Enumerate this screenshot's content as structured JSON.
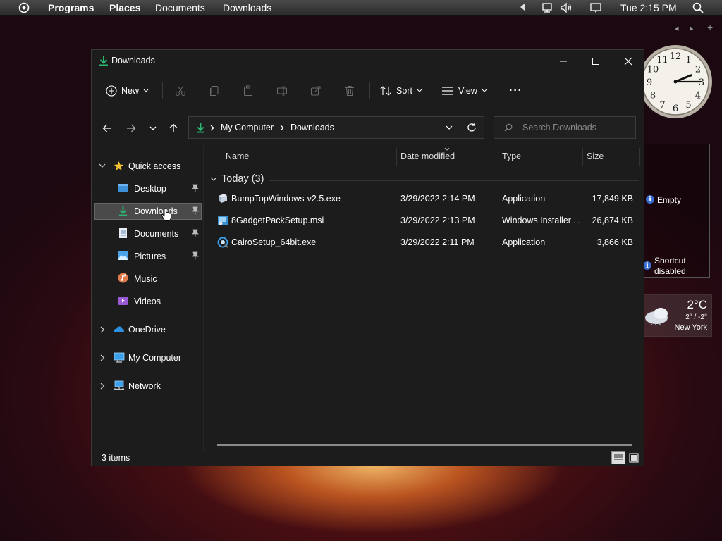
{
  "topbar": {
    "menus": [
      "Programs",
      "Places",
      "Documents",
      "Downloads"
    ],
    "clock": "Tue 2:15 PM"
  },
  "gadgets": {
    "nav_prev": "◂",
    "nav_next": "▸",
    "nav_add": "+",
    "recycle_empty": "Empty",
    "shortcut_line1": "Shortcut",
    "shortcut_line2": "disabled",
    "weather": {
      "temp": "2°C",
      "range": "2° / -2°",
      "city": "New York"
    },
    "clock_numbers": [
      "12",
      "1",
      "2",
      "3",
      "4",
      "5",
      "6",
      "7",
      "8",
      "9",
      "10",
      "11"
    ]
  },
  "window": {
    "title": "Downloads",
    "accent": "#2bb673",
    "toolbar": {
      "new_label": "New",
      "sort_label": "Sort",
      "view_label": "View",
      "more_label": "···"
    },
    "address": {
      "root": "My Computer",
      "current": "Downloads"
    },
    "search_placeholder": "Search Downloads",
    "sidebar": {
      "quick_access": "Quick access",
      "items": [
        {
          "label": "Desktop",
          "icon": "desktop-icon",
          "pinned": true
        },
        {
          "label": "Downloads",
          "icon": "download-icon",
          "pinned": true,
          "selected": true
        },
        {
          "label": "Documents",
          "icon": "document-icon",
          "pinned": true
        },
        {
          "label": "Pictures",
          "icon": "picture-icon",
          "pinned": true
        },
        {
          "label": "Music",
          "icon": "music-icon",
          "pinned": false
        },
        {
          "label": "Videos",
          "icon": "video-icon",
          "pinned": false
        }
      ],
      "onedrive": "OneDrive",
      "computer": "My Computer",
      "network": "Network"
    },
    "columns": {
      "name": "Name",
      "date": "Date modified",
      "type": "Type",
      "size": "Size"
    },
    "group": "Today (3)",
    "files": [
      {
        "name": "BumpTopWindows-v2.5.exe",
        "date": "3/29/2022 2:14 PM",
        "type": "Application",
        "size": "17,849 KB"
      },
      {
        "name": "8GadgetPackSetup.msi",
        "date": "3/29/2022 2:13 PM",
        "type": "Windows Installer ...",
        "size": "26,874 KB"
      },
      {
        "name": "CairoSetup_64bit.exe",
        "date": "3/29/2022 2:11 PM",
        "type": "Application",
        "size": "3,866 KB"
      }
    ],
    "status": "3 items"
  }
}
